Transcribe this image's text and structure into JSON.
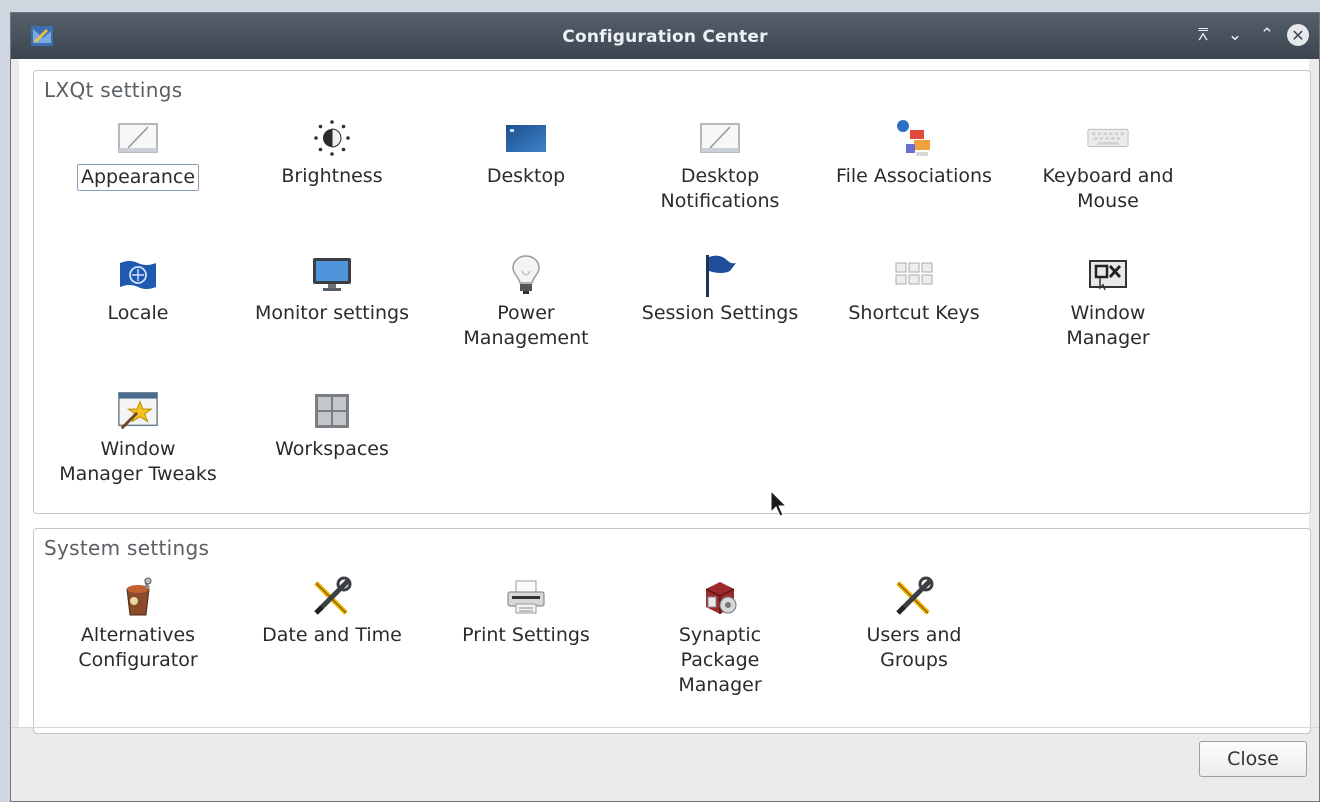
{
  "window": {
    "title": "Configuration Center"
  },
  "titlebar": {
    "icons": [
      "app-icon",
      "keep-above-icon",
      "minimize-icon",
      "maximize-icon",
      "close-icon"
    ]
  },
  "lxqt": {
    "title": "LXQt settings",
    "items": [
      {
        "label": "Appearance",
        "icon": "appearance-icon",
        "selected": true
      },
      {
        "label": "Brightness",
        "icon": "brightness-icon"
      },
      {
        "label": "Desktop",
        "icon": "desktop-icon"
      },
      {
        "label": "Desktop\nNotifications",
        "icon": "notifications-icon"
      },
      {
        "label": "File Associations",
        "icon": "file-associations-icon"
      },
      {
        "label": "Keyboard and\nMouse",
        "icon": "keyboard-icon"
      },
      {
        "label": "Locale",
        "icon": "locale-icon"
      },
      {
        "label": "Monitor settings",
        "icon": "monitor-icon"
      },
      {
        "label": "Power\nManagement",
        "icon": "lightbulb-icon"
      },
      {
        "label": "Session Settings",
        "icon": "flag-icon"
      },
      {
        "label": "Shortcut Keys",
        "icon": "shortcut-keys-icon"
      },
      {
        "label": "Window\nManager",
        "icon": "window-manager-icon"
      },
      {
        "label": "Window\nManager Tweaks",
        "icon": "window-tweaks-icon"
      },
      {
        "label": "Workspaces",
        "icon": "workspaces-icon"
      }
    ]
  },
  "system": {
    "title": "System settings",
    "items": [
      {
        "label": "Alternatives\nConfigurator",
        "icon": "alternatives-icon"
      },
      {
        "label": "Date and Time",
        "icon": "tools-icon"
      },
      {
        "label": "Print Settings",
        "icon": "printer-icon"
      },
      {
        "label": "Synaptic\nPackage\nManager",
        "icon": "package-manager-icon"
      },
      {
        "label": "Users and\nGroups",
        "icon": "tools-icon"
      }
    ]
  },
  "buttons": {
    "close": "Close"
  },
  "colors": {
    "titlebar": "#434c56",
    "accent": "#2f6fb7",
    "selection_border": "#8aa0b8"
  }
}
